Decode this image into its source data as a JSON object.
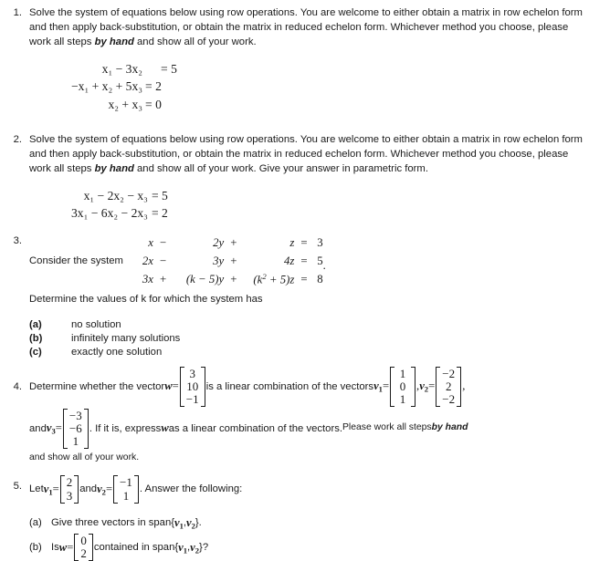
{
  "document": {
    "problems": [
      {
        "number": "1.",
        "text_parts": {
          "a": "Solve the system of equations below using row operations.  You are welcome to either obtain a matrix in row echelon form and then apply back-substitution, or obtain the matrix in reduced echelon form.  Whichever method you choose, please work all steps ",
          "emph": "by hand",
          "b": " and show all of your work."
        },
        "system": [
          {
            "lhs": "x₁ − 3x₂",
            "rhs": "= 5"
          },
          {
            "lhs": "−x₁ + x₂ + 5x₃",
            "rhs": "= 2"
          },
          {
            "lhs": "x₂ + x₃",
            "rhs": "= 0"
          }
        ]
      },
      {
        "number": "2.",
        "text_parts": {
          "a": "Solve the system of equations below using row operations.  You are welcome to either obtain a matrix in row echelon form and then apply back-substitution, or obtain the matrix in reduced echelon form.  Whichever method you choose, please work all steps ",
          "emph": "by hand",
          "b": " and show all of your work.  Give your answer in parametric form."
        },
        "system": [
          {
            "lhs": "x₁ − 2x₂ − x₃",
            "rhs": "= 5"
          },
          {
            "lhs": "3x₁ − 6x₂ − 2x₃",
            "rhs": "= 2"
          }
        ]
      },
      {
        "number": "3.",
        "lead": "Consider the system",
        "trailing_period": ".",
        "system_rows": [
          {
            "x": "x",
            "op1": "−",
            "y": "2y",
            "op2": "+",
            "z": "z",
            "eq": "=",
            "rhs": "3"
          },
          {
            "x": "2x",
            "op1": "−",
            "y": "3y",
            "op2": "+",
            "z": "4z",
            "eq": "=",
            "rhs": "5"
          },
          {
            "x": "3x",
            "op1": "+",
            "y": "(k − 5)y",
            "op2": "+",
            "z_pre": "(k",
            "z_sup": "2",
            "z_post": " + 5)z",
            "eq": "=",
            "rhs": "8"
          }
        ],
        "determine": "Determine the values of k for which the system has",
        "options": [
          {
            "label": "(a)",
            "text": "no solution"
          },
          {
            "label": "(b)",
            "text": "infinitely many solutions"
          },
          {
            "label": "(c)",
            "text": "exactly one solution"
          }
        ]
      },
      {
        "number": "4.",
        "seg1": "Determine whether the vector ",
        "w_name": "w",
        "eq1": " = ",
        "w_vector": [
          "3",
          "10",
          "−1"
        ],
        "seg2": " is a linear combination of the vectors ",
        "v1_name": "v",
        "v1_sub": "1",
        "v1_vector": [
          "1",
          "0",
          "1"
        ],
        "sep1": " , ",
        "v2_name": "v",
        "v2_sub": "2",
        "v2_vector": [
          "−2",
          "2",
          "−2"
        ],
        "sep2": ",",
        "seg3": "and ",
        "v3_name": "v",
        "v3_sub": "3",
        "v3_vector": [
          "−3",
          "−6",
          "1"
        ],
        "seg4": ". If it is, express ",
        "w_name2": "w",
        "seg5": " as a linear combination of the vectors.  ",
        "seg6": "Please work all steps ",
        "emph": "by hand",
        "seg7": "and show all of your work."
      },
      {
        "number": "5.",
        "seg1": "Let ",
        "v1_name": "v",
        "v1_sub": "1",
        "eq1": " = ",
        "v1_vector": [
          "2",
          "3"
        ],
        "seg2": " and ",
        "v2_name": "v",
        "v2_sub": "2",
        "eq2": " = ",
        "v2_vector": [
          "−1",
          "1"
        ],
        "seg3": ". Answer the following:",
        "parts": [
          {
            "label": "(a)",
            "text_a": "Give three vectors in span{",
            "sp1": "v",
            "sp1sub": "1",
            "comma": ", ",
            "sp2": "v",
            "sp2sub": "2",
            "text_b": "}."
          },
          {
            "label": "(b)",
            "text_a": "Is ",
            "w_name": "w",
            "eq": " = ",
            "vector": [
              "0",
              "2"
            ],
            "text_b": " contained in span{",
            "sp1": "v",
            "sp1sub": "1",
            "comma": ", ",
            "sp2": "v",
            "sp2sub": "2",
            "text_c": "}?"
          }
        ]
      }
    ]
  }
}
